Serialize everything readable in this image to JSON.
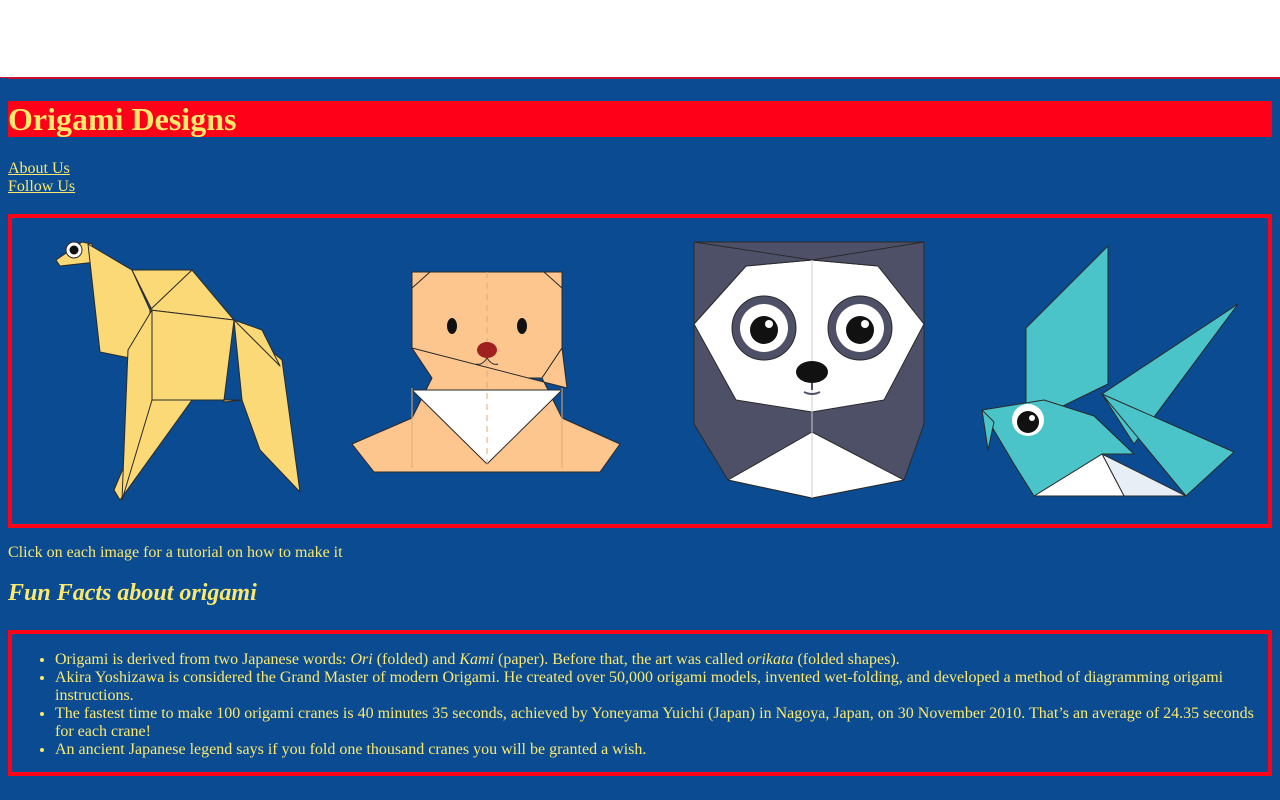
{
  "site": {
    "title": "Origami Designs"
  },
  "nav": {
    "items": [
      {
        "label": "About Us"
      },
      {
        "label": "Follow Us"
      }
    ]
  },
  "gallery": {
    "images": [
      {
        "name": "camel",
        "color": "#fbd977"
      },
      {
        "name": "hamster",
        "color": "#fdc68e"
      },
      {
        "name": "panda",
        "color": "#4e5068"
      },
      {
        "name": "bird",
        "color": "#4bc4c9"
      }
    ],
    "caption": "Click on each image for a tutorial on how to make it"
  },
  "facts": {
    "heading": "Fun Facts about origami",
    "items": [
      {
        "p1": "Origami is derived from two Japanese words: ",
        "em1": "Ori",
        "p2": " (folded) and ",
        "em2": "Kami",
        "p3": " (paper). Before that, the art was called ",
        "em3": "orikata",
        "p4": " (folded shapes)."
      },
      {
        "text": "Akira Yoshizawa is considered the Grand Master of modern Origami. He created over 50,000 origami models, invented wet-folding, and developed a method of diagramming origami instructions."
      },
      {
        "text": "The fastest time to make 100 origami cranes is 40 minutes 35 seconds, achieved by Yoneyama Yuichi (Japan) in Nagoya, Japan, on 30 November 2010. That’s an average of 24.35 seconds for each crane!"
      },
      {
        "text": "An ancient Japanese legend says if you fold one thousand cranes you will be granted a wish."
      }
    ]
  },
  "colors": {
    "background": "#0a4b92",
    "accent_red": "#ff0019",
    "text_yellow": "#fbe96e"
  }
}
